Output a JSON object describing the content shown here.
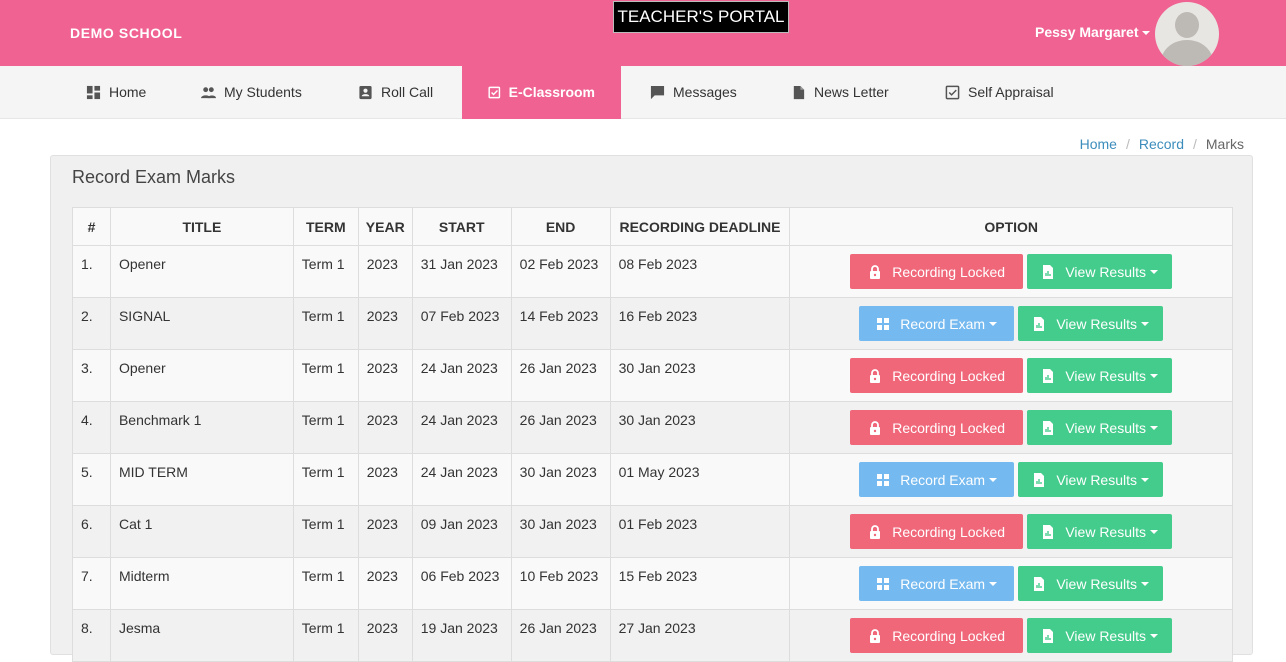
{
  "header": {
    "school_name": "DEMO SCHOOL",
    "portal_title": "TEACHER'S PORTAL",
    "user_name": "Pessy Margaret"
  },
  "nav": {
    "items": [
      {
        "label": "Home",
        "icon": "dashboard-icon"
      },
      {
        "label": "My Students",
        "icon": "people-icon"
      },
      {
        "label": "Roll Call",
        "icon": "contact-card-icon"
      },
      {
        "label": "E-Classroom",
        "icon": "checkbox-icon",
        "active": true
      },
      {
        "label": "Messages",
        "icon": "message-icon"
      },
      {
        "label": "News Letter",
        "icon": "document-icon"
      },
      {
        "label": "Self Appraisal",
        "icon": "checkbox-outline-icon"
      }
    ]
  },
  "breadcrumb": {
    "home": "Home",
    "record": "Record",
    "current": "Marks"
  },
  "panel": {
    "title": "Record Exam Marks"
  },
  "table": {
    "headers": [
      "#",
      "TITLE",
      "TERM",
      "YEAR",
      "START",
      "END",
      "RECORDING DEADLINE",
      "OPTION"
    ],
    "rows": [
      {
        "num": "1.",
        "title": "Opener",
        "term": "Term 1",
        "year": "2023",
        "start": "31 Jan 2023",
        "end": "02 Feb 2023",
        "deadline": "08 Feb 2023",
        "locked": true
      },
      {
        "num": "2.",
        "title": "SIGNAL",
        "term": "Term 1",
        "year": "2023",
        "start": "07 Feb 2023",
        "end": "14 Feb 2023",
        "deadline": "16 Feb 2023",
        "locked": false
      },
      {
        "num": "3.",
        "title": "Opener",
        "term": "Term 1",
        "year": "2023",
        "start": "24 Jan 2023",
        "end": "26 Jan 2023",
        "deadline": "30 Jan 2023",
        "locked": true
      },
      {
        "num": "4.",
        "title": "Benchmark 1",
        "term": "Term 1",
        "year": "2023",
        "start": "24 Jan 2023",
        "end": "26 Jan 2023",
        "deadline": "30 Jan 2023",
        "locked": true
      },
      {
        "num": "5.",
        "title": "MID TERM",
        "term": "Term 1",
        "year": "2023",
        "start": "24 Jan 2023",
        "end": "30 Jan 2023",
        "deadline": "01 May 2023",
        "locked": false
      },
      {
        "num": "6.",
        "title": "Cat 1",
        "term": "Term 1",
        "year": "2023",
        "start": "09 Jan 2023",
        "end": "30 Jan 2023",
        "deadline": "01 Feb 2023",
        "locked": true
      },
      {
        "num": "7.",
        "title": "Midterm",
        "term": "Term 1",
        "year": "2023",
        "start": "06 Feb 2023",
        "end": "10 Feb 2023",
        "deadline": "15 Feb 2023",
        "locked": false
      },
      {
        "num": "8.",
        "title": "Jesma",
        "term": "Term 1",
        "year": "2023",
        "start": "19 Jan 2023",
        "end": "26 Jan 2023",
        "deadline": "27 Jan 2023",
        "locked": true
      }
    ]
  },
  "buttons": {
    "locked_label": "Recording Locked",
    "record_label": "Record Exam",
    "view_label": "View Results"
  },
  "colors": {
    "brand_pink": "#f06292",
    "locked_red": "#f0677a",
    "record_blue": "#74b9ef",
    "view_green": "#44cc8c",
    "link_blue": "#3c8dbc"
  }
}
